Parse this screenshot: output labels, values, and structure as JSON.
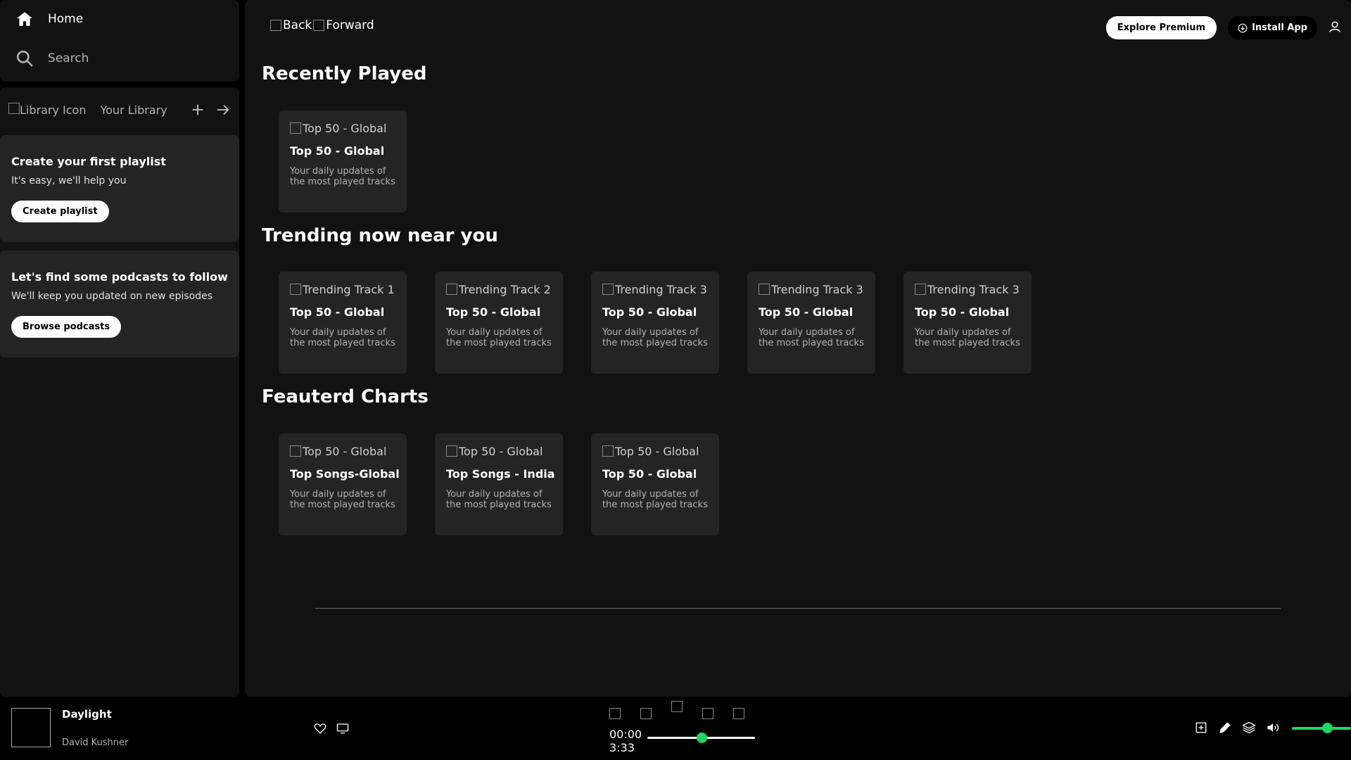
{
  "sidebar": {
    "nav": {
      "home_label": "Home",
      "search_label": "Search"
    },
    "library": {
      "icon_alt": "Library Icon",
      "title": "Your Library"
    },
    "promos": [
      {
        "title": "Create your first playlist",
        "text": "It's easy, we'll help you",
        "button": "Create playlist"
      },
      {
        "title": "Let's find some podcasts to follow",
        "text": "We'll keep you updated on new episodes",
        "button": "Browse podcasts"
      }
    ]
  },
  "header": {
    "back_alt": "Back",
    "forward_alt": "Forward",
    "premium_button": "Explore Premium",
    "install_button": "Install App"
  },
  "sections": [
    {
      "title": "Recently Played",
      "cards": [
        {
          "img_alt": "Top 50 - Global",
          "title": "Top 50 - Global",
          "desc": "Your daily updates of the most played tracks"
        }
      ]
    },
    {
      "title": "Trending now near you",
      "cards": [
        {
          "img_alt": "Trending Track 1",
          "title": "Top 50 - Global",
          "desc": "Your daily updates of the most played tracks"
        },
        {
          "img_alt": "Trending Track 2",
          "title": "Top 50 - Global",
          "desc": "Your daily updates of the most played tracks"
        },
        {
          "img_alt": "Trending Track 3",
          "title": "Top 50 - Global",
          "desc": "Your daily updates of the most played tracks"
        },
        {
          "img_alt": "Trending Track 3",
          "title": "Top 50 - Global",
          "desc": "Your daily updates of the most played tracks"
        },
        {
          "img_alt": "Trending Track 3",
          "title": "Top 50 - Global",
          "desc": "Your daily updates of the most played tracks"
        }
      ]
    },
    {
      "title": "Feauterd Charts",
      "cards": [
        {
          "img_alt": "Top 50 - Global",
          "title": "Top Songs-Global",
          "desc": "Your daily updates of the most played tracks"
        },
        {
          "img_alt": "Top 50 - Global",
          "title": "Top Songs - India",
          "desc": "Your daily updates of the most played tracks"
        },
        {
          "img_alt": "Top 50 - Global",
          "title": "Top 50 - Global",
          "desc": "Your daily updates of the most played tracks"
        }
      ]
    }
  ],
  "player": {
    "track": "Daylight",
    "artist": "David Kushner",
    "current_time": "00:00",
    "total_time": "3:33",
    "progress_fraction": 0.5,
    "volume_fraction": 0.6
  },
  "colors": {
    "accent": "#1ed760",
    "panel": "#121212",
    "card": "#242424"
  }
}
